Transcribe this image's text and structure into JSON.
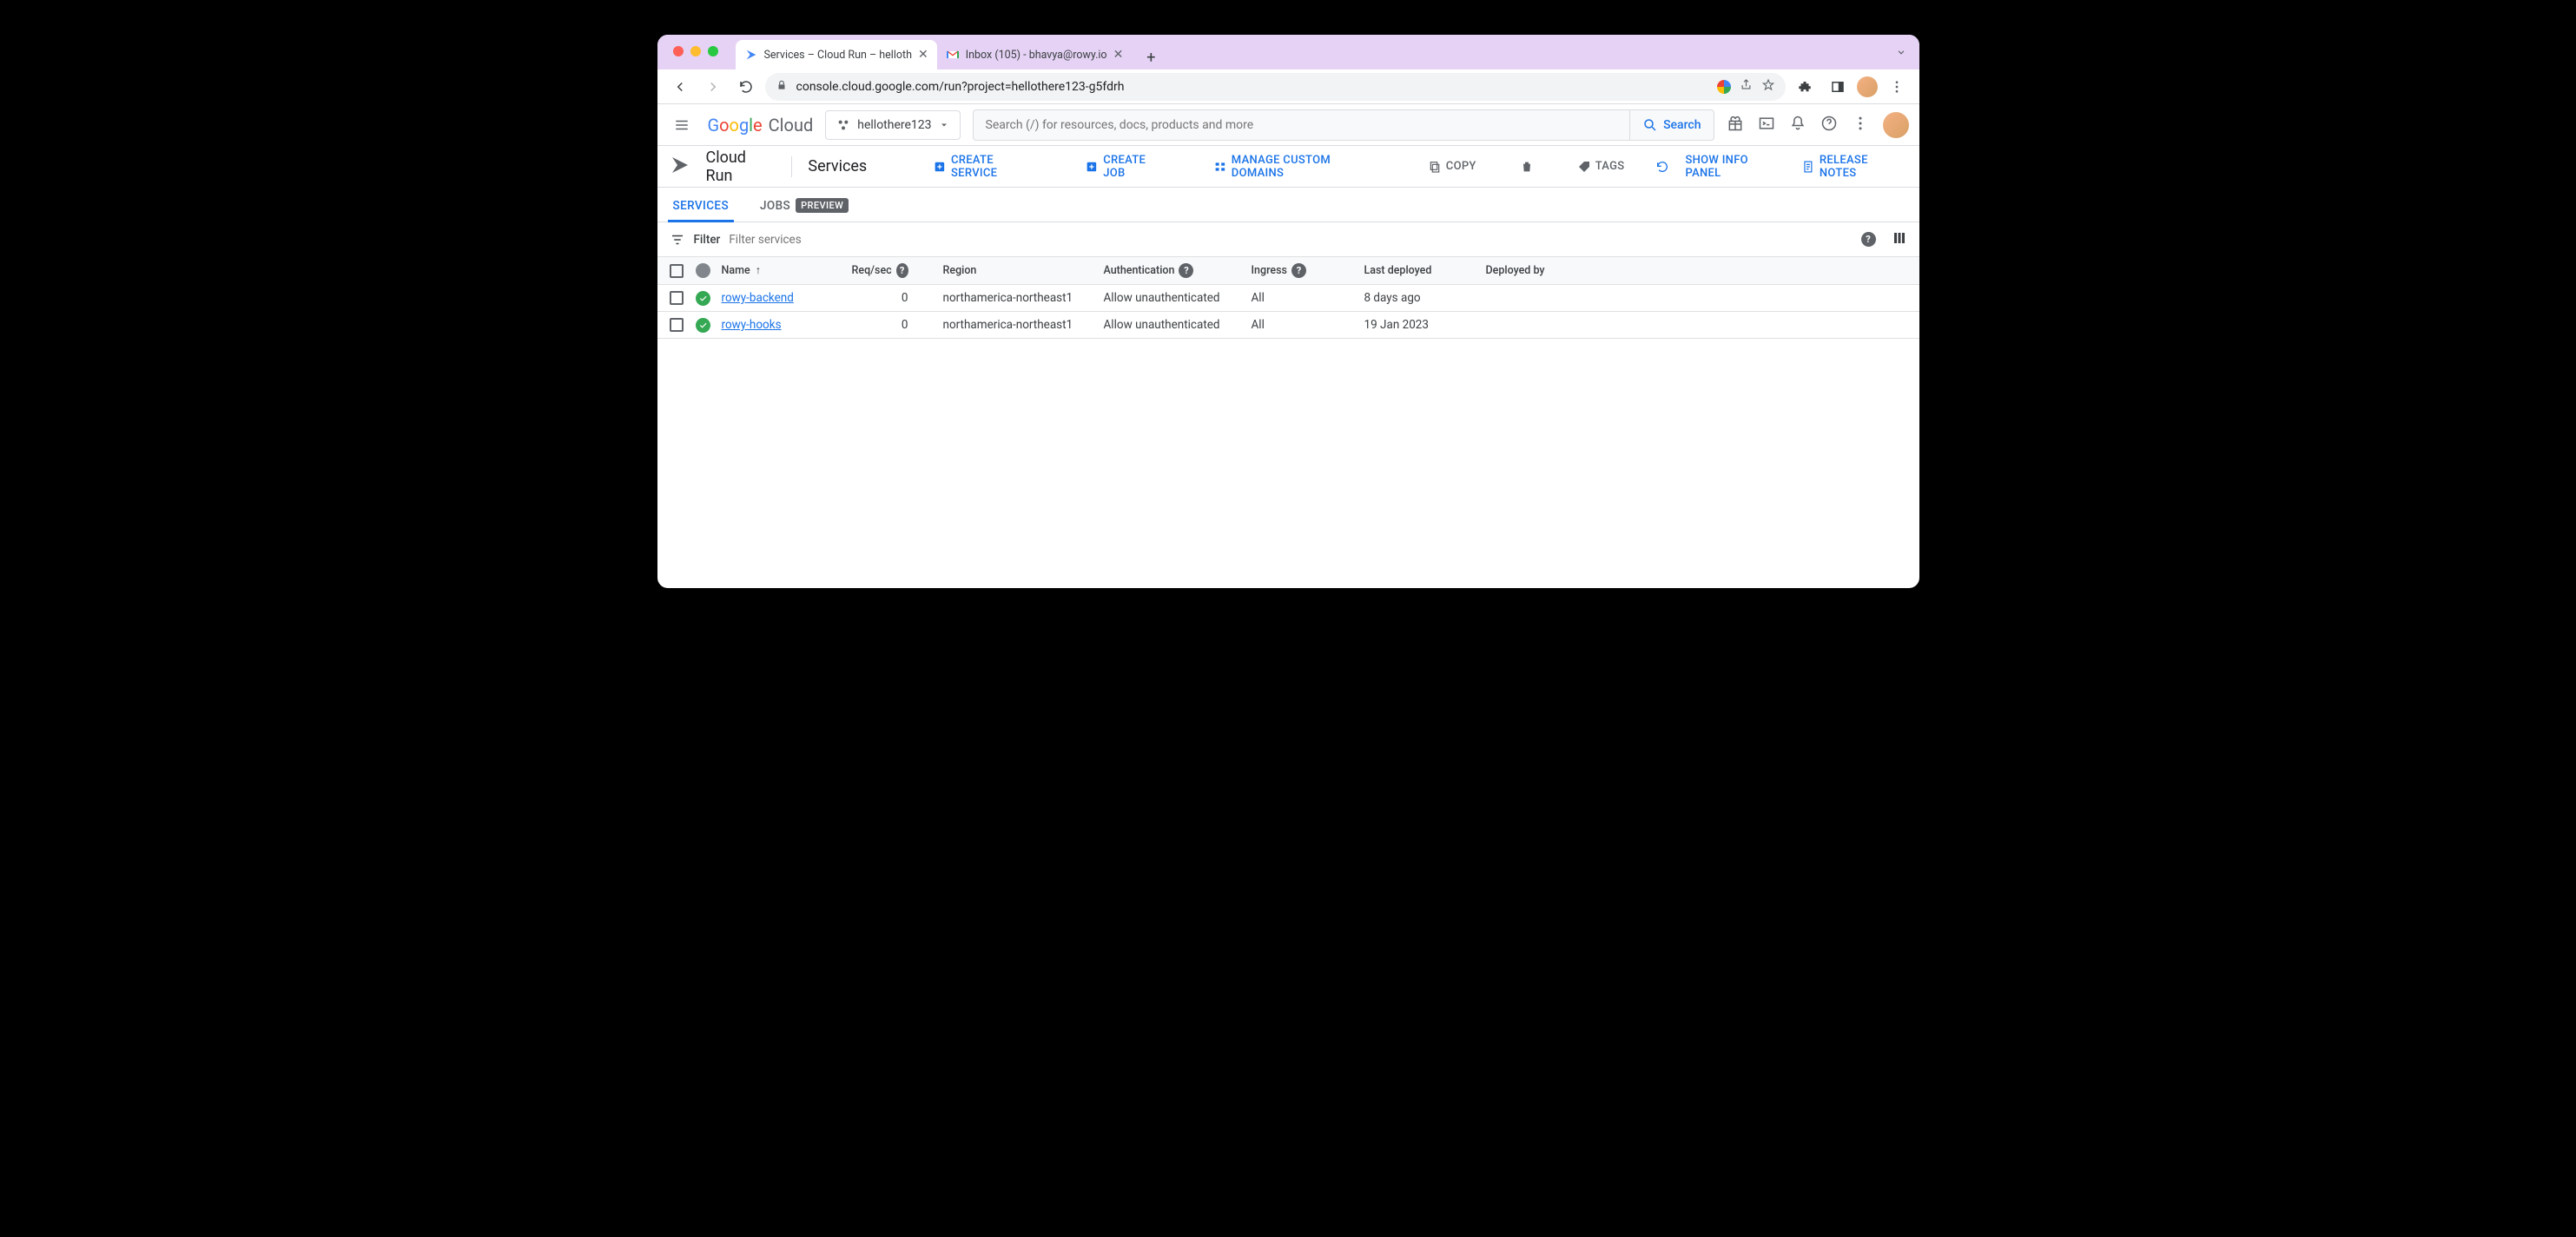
{
  "browser": {
    "tabs": [
      {
        "title": "Services – Cloud Run – helloth",
        "active": true
      },
      {
        "title": "Inbox (105) - bhavya@rowy.io",
        "active": false
      }
    ],
    "url": "console.cloud.google.com/run?project=hellothere123-g5fdrh"
  },
  "gcp": {
    "logo_google": "Google",
    "logo_cloud": "Cloud",
    "project": "hellothere123",
    "search_placeholder": "Search (/) for resources, docs, products and more",
    "search_button": "Search"
  },
  "service_header": {
    "product": "Cloud Run",
    "section": "Services",
    "actions": {
      "create_service": "CREATE SERVICE",
      "create_job": "CREATE JOB",
      "manage_domains": "MANAGE CUSTOM DOMAINS",
      "copy": "COPY",
      "tags": "TAGS",
      "show_info": "SHOW INFO PANEL",
      "release_notes": "RELEASE NOTES"
    }
  },
  "subtabs": {
    "services": "SERVICES",
    "jobs": "JOBS",
    "preview_badge": "PREVIEW"
  },
  "filter": {
    "label": "Filter",
    "placeholder": "Filter services"
  },
  "table": {
    "headers": {
      "name": "Name",
      "req": "Req/sec",
      "region": "Region",
      "auth": "Authentication",
      "ingress": "Ingress",
      "deployed": "Last deployed",
      "by": "Deployed by"
    },
    "rows": [
      {
        "name": "rowy-backend",
        "req": "0",
        "region": "northamerica-northeast1",
        "auth": "Allow unauthenticated",
        "ingress": "All",
        "deployed": "8 days ago",
        "by": ""
      },
      {
        "name": "rowy-hooks",
        "req": "0",
        "region": "northamerica-northeast1",
        "auth": "Allow unauthenticated",
        "ingress": "All",
        "deployed": "19 Jan 2023",
        "by": ""
      }
    ]
  }
}
